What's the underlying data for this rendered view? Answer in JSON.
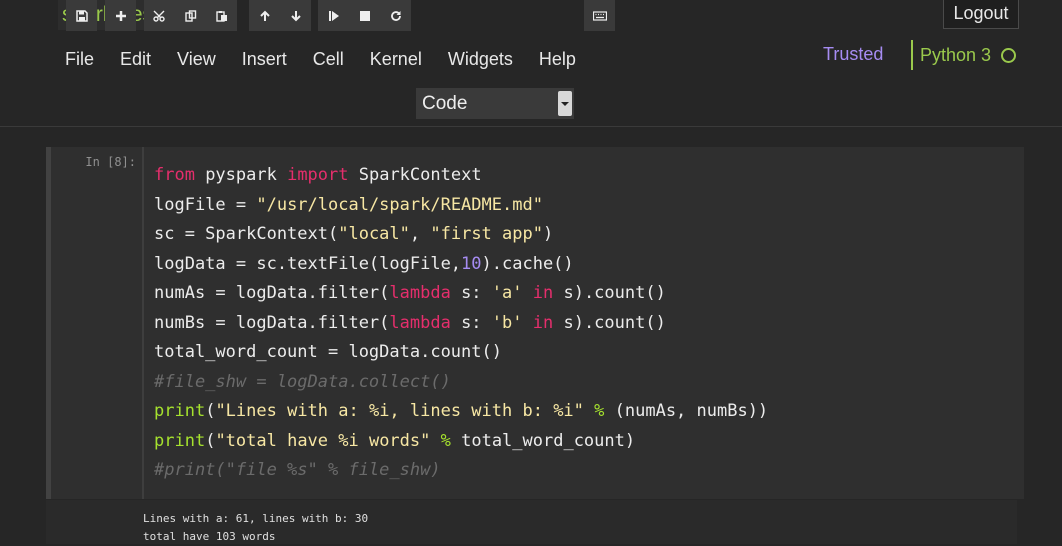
{
  "header": {
    "notebook_title": "spark_test1",
    "logout_label": "Logout",
    "trusted_label": "Trusted",
    "kernel_name": "Python 3"
  },
  "menu": {
    "items": [
      "File",
      "Edit",
      "View",
      "Insert",
      "Cell",
      "Kernel",
      "Widgets",
      "Help"
    ]
  },
  "toolbar": {
    "buttons": [
      {
        "group": 1,
        "icon": "save-icon"
      },
      {
        "group": 2,
        "icon": "plus-icon"
      },
      {
        "group": 3,
        "icon": "cut-icon"
      },
      {
        "group": 3,
        "icon": "copy-icon"
      },
      {
        "group": 3,
        "icon": "paste-icon"
      },
      {
        "group": 4,
        "icon": "arrow-up-icon"
      },
      {
        "group": 4,
        "icon": "arrow-down-icon"
      },
      {
        "group": 5,
        "icon": "run-step-icon"
      },
      {
        "group": 5,
        "icon": "stop-icon"
      },
      {
        "group": 5,
        "icon": "restart-icon"
      },
      {
        "group": 6,
        "icon": "keyboard-icon"
      }
    ],
    "cell_type": "Code"
  },
  "cell": {
    "prompt": "In [8]:",
    "code_lines": [
      [
        {
          "t": "from",
          "c": "kw"
        },
        {
          "t": " pyspark "
        },
        {
          "t": "import",
          "c": "kw"
        },
        {
          "t": " SparkContext"
        }
      ],
      [
        {
          "t": "logFile = "
        },
        {
          "t": "\"/usr/local/spark/README.md\"",
          "c": "st"
        }
      ],
      [
        {
          "t": "sc = SparkContext("
        },
        {
          "t": "\"local\"",
          "c": "st"
        },
        {
          "t": ", "
        },
        {
          "t": "\"first app\"",
          "c": "st"
        },
        {
          "t": ")"
        }
      ],
      [
        {
          "t": "logData = sc.textFile(logFile,"
        },
        {
          "t": "10",
          "c": "nu"
        },
        {
          "t": ").cache()"
        }
      ],
      [
        {
          "t": "numAs = logData.filter("
        },
        {
          "t": "lambda",
          "c": "kw"
        },
        {
          "t": " s: "
        },
        {
          "t": "'a'",
          "c": "st"
        },
        {
          "t": " "
        },
        {
          "t": "in",
          "c": "kw"
        },
        {
          "t": " s).count()"
        }
      ],
      [
        {
          "t": "numBs = logData.filter("
        },
        {
          "t": "lambda",
          "c": "kw"
        },
        {
          "t": " s: "
        },
        {
          "t": "'b'",
          "c": "st"
        },
        {
          "t": " "
        },
        {
          "t": "in",
          "c": "kw"
        },
        {
          "t": " s).count()"
        }
      ],
      [
        {
          "t": "total_word_count = logData.count()"
        }
      ],
      [
        {
          "t": "#file_shw = logData.collect()",
          "c": "cm"
        }
      ],
      [
        {
          "t": "print",
          "c": "fn"
        },
        {
          "t": "("
        },
        {
          "t": "\"Lines with a: %i, lines with b: %i\"",
          "c": "st"
        },
        {
          "t": " "
        },
        {
          "t": "%",
          "c": "op"
        },
        {
          "t": " (numAs, numBs))"
        }
      ],
      [
        {
          "t": "print",
          "c": "fn"
        },
        {
          "t": "("
        },
        {
          "t": "\"total have %i words\"",
          "c": "st"
        },
        {
          "t": " "
        },
        {
          "t": "%",
          "c": "op"
        },
        {
          "t": " total_word_count)"
        }
      ],
      [
        {
          "t": "#print(\"file %s\" % file_shw)",
          "c": "cm"
        }
      ]
    ],
    "output_lines": [
      "Lines with a: 61, lines with b: 30",
      "total have 103 words"
    ]
  }
}
